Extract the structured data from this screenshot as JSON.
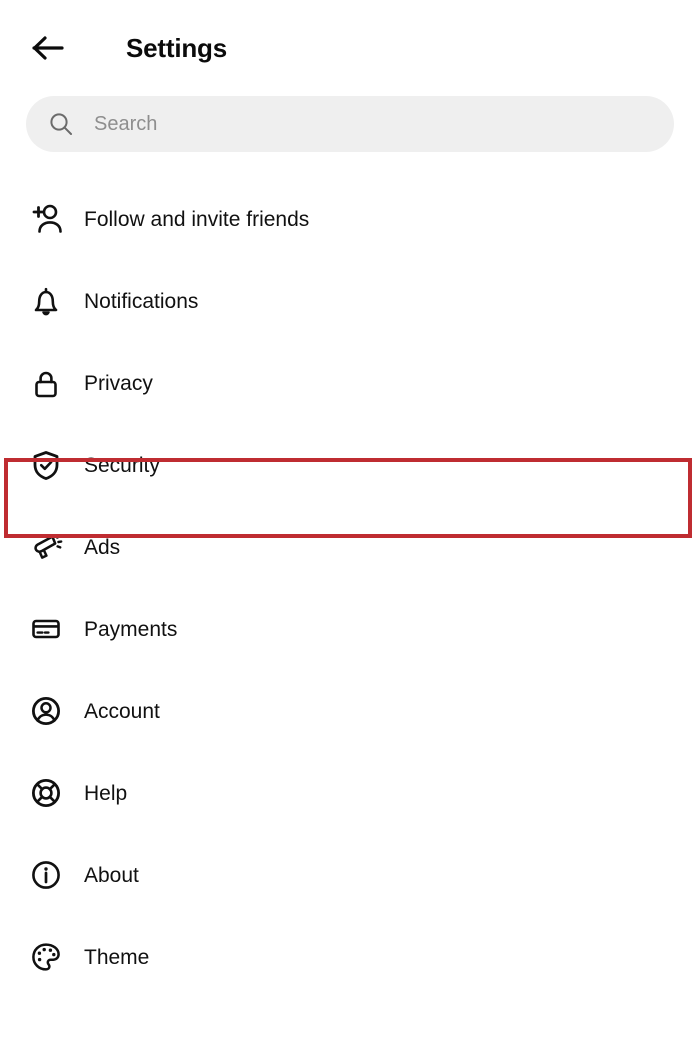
{
  "header": {
    "back_icon": "arrow-left-icon",
    "title": "Settings"
  },
  "search": {
    "icon": "search-icon",
    "placeholder": "Search",
    "value": ""
  },
  "list": {
    "items": [
      {
        "label": "Follow and invite friends",
        "icon": "person-add-icon"
      },
      {
        "label": "Notifications",
        "icon": "bell-icon"
      },
      {
        "label": "Privacy",
        "icon": "lock-icon"
      },
      {
        "label": "Security",
        "icon": "shield-check-icon"
      },
      {
        "label": "Ads",
        "icon": "megaphone-icon"
      },
      {
        "label": "Payments",
        "icon": "credit-card-icon"
      },
      {
        "label": "Account",
        "icon": "person-circle-icon"
      },
      {
        "label": "Help",
        "icon": "lifebuoy-icon"
      },
      {
        "label": "About",
        "icon": "info-circle-icon"
      },
      {
        "label": "Theme",
        "icon": "palette-icon"
      }
    ]
  },
  "highlight": {
    "target_label": "Security",
    "color": "#bf2c31"
  },
  "colors": {
    "background": "#ffffff",
    "text": "#111111",
    "placeholder": "#8e8e8e",
    "search_background": "#efefef",
    "highlight": "#bf2c31"
  }
}
